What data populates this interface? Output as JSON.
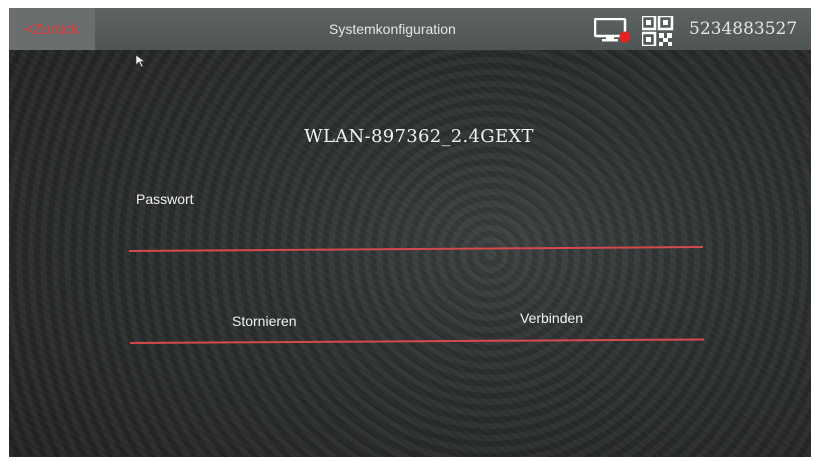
{
  "header": {
    "back_label": "<Zurück",
    "title": "Systemkonfiguration",
    "device_id": "5234883527"
  },
  "network": {
    "ssid": "WLAN-897362_2.4GEXT"
  },
  "password": {
    "label": "Passwort",
    "value": ""
  },
  "actions": {
    "cancel_label": "Stornieren",
    "connect_label": "Verbinden"
  },
  "colors": {
    "accent": "#d54a4a",
    "status_dot": "#e52222"
  },
  "icons": {
    "monitor": "monitor-status-icon",
    "qr": "qr-code-icon",
    "cursor": "mouse-pointer-icon"
  }
}
